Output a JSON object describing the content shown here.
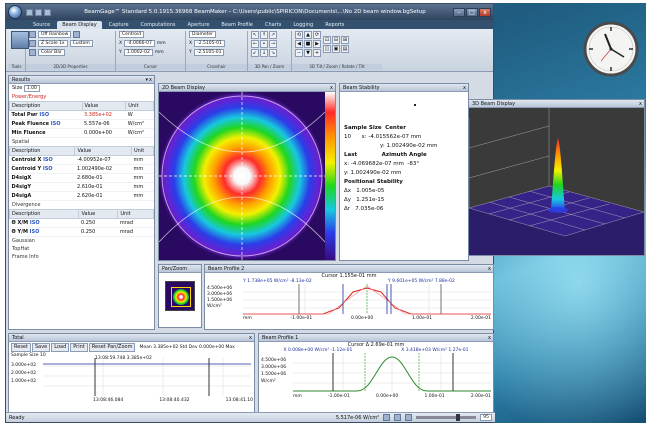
{
  "window": {
    "title": "BeamGage™ Standard 5.0.1915.36968 BeamMaker – C:\\Users\\public\\SPIRICON\\Documents\\...\\No 2D beam window.bgSetup",
    "minimize": "–",
    "maximize": "□",
    "close": "x"
  },
  "ribbon": {
    "tabs": [
      "Source",
      "Beam Display",
      "Capture",
      "Computations",
      "Aperture",
      "Beam Profile",
      "Charts",
      "Logging",
      "Reports"
    ],
    "active_tab": "Beam Display",
    "palette_label": "Off Rainbow",
    "scale_label": "Z Scale 1x",
    "colorbar_label": "Color Bar",
    "custom_label": "Custom",
    "centroid_label": "Centroid",
    "diameter_label": "Diameter",
    "x_value": "-4.0066-07",
    "y_value": "1.0002-02",
    "x2_value": "-2.5105-01",
    "y2_value": "-2.5105-01",
    "unit": "mm",
    "groups": [
      "Tools",
      "2D/3D Properties",
      "Cursor",
      "Crosshair",
      "3D Pan / Zoom",
      "3D Tilt / Zoom / Rotate / Tilt"
    ]
  },
  "results": {
    "title": "Results",
    "size_label": "Size",
    "size_value": "1.00",
    "sections": {
      "power": "Power/Energy",
      "spatial": "Spatial",
      "divergence": "Divergence",
      "gaussian": "Gaussian",
      "tophat": "TopHat",
      "frame": "Frame Info"
    },
    "columns": [
      "Description",
      "Value",
      "Unit"
    ],
    "power_rows": [
      {
        "desc": "Total Pwr",
        "iso": "ISO",
        "value": "3.385e+02",
        "unit": "W"
      },
      {
        "desc": "Peak Fluence",
        "iso": "ISO",
        "value": "5.557e-06",
        "unit": "W/cm²"
      },
      {
        "desc": "Min Fluence",
        "iso": "",
        "value": "0.000e+00",
        "unit": "W/cm²"
      }
    ],
    "spatial_rows": [
      {
        "desc": "Centroid X",
        "iso": "ISO",
        "value": "-4.00952e-07",
        "unit": "mm"
      },
      {
        "desc": "Centroid Y",
        "iso": "ISO",
        "value": "1.002490e-02",
        "unit": "mm"
      },
      {
        "desc": "D4sigX",
        "iso": "",
        "value": "2.680e-01",
        "unit": "mm"
      },
      {
        "desc": "D4sigY",
        "iso": "",
        "value": "2.610e-01",
        "unit": "mm"
      },
      {
        "desc": "D4sigA",
        "iso": "",
        "value": "2.620e-01",
        "unit": "mm"
      }
    ],
    "div_rows": [
      {
        "desc": "Θ X/M",
        "iso": "ISO",
        "value": "0.250",
        "unit": "mrad"
      },
      {
        "desc": "Θ Y/M",
        "iso": "ISO",
        "value": "0.250",
        "unit": "mrad"
      }
    ]
  },
  "beam2d": {
    "title": "2D Beam Display"
  },
  "stability": {
    "title": "Beam Stability",
    "sample_size_label": "Sample Size",
    "sample_size": "10",
    "center_label": "Center",
    "center_x": "-4.015562e-07 mm",
    "center_y": "1.002490e-02 mm",
    "last_label": "Last",
    "azimuth_label": "Azimuth Angle",
    "last_x": "-4.069682e-07 mm",
    "last_y": "1.002490e-02 mm",
    "angle": "-83°",
    "positional_label": "Positional Stability",
    "dx": "1.005e-05",
    "dy": "1.251e-15",
    "dr": "7.035e-06"
  },
  "beam3d": {
    "title": "3D Beam Display"
  },
  "panzoom": {
    "title": "Pan/Zoom"
  },
  "bp2": {
    "title": "Beam Profile 2",
    "cursor": "Cursor 1.155e-01 mm",
    "left_marker": "Y 1.738e+05 W/cm²  -8.13e-02",
    "right_marker": "Y 9.601e+05 W/cm²  7.88e-02",
    "y_ticks": [
      "4.500e+06",
      "3.000e+06",
      "1.500e+06"
    ],
    "y_unit": "W/cm²",
    "x_ticks": [
      "-2.00e-01",
      "-1.00e-01",
      "0.00e+00",
      "1.00e-01",
      "2.00e-01"
    ],
    "x_unit": "mm"
  },
  "total": {
    "title": "Total",
    "buttons": [
      "Reset",
      "Save",
      "Load",
      "Print",
      "Reset Pan/Zoom"
    ],
    "stats": "Mean 3.385e+02  Std Dev 0.000e+00  Max",
    "sample_size": "Sample Size 10",
    "marker": "13:08:59.748  3.385e+02",
    "y_ticks": [
      "3.000e+02",
      "2.000e+02",
      "1.000e+02"
    ],
    "x_ticks": [
      "13:08:46.084",
      "13:08:40.432",
      "13:08:41.10"
    ]
  },
  "bp1": {
    "title": "Beam Profile 1",
    "cursor": "Cursor Δ 2.69e-01 mm",
    "left_marker": "X 0.008e+00 W/cm²  -1.12e-01",
    "right_marker": "X 3.418e+03 W/cm²  1.27e-01",
    "y_ticks": [
      "4.500e+06",
      "3.000e+06",
      "1.500e+06"
    ],
    "y_unit": "W/cm²",
    "x_ticks": [
      "-2.00e-01",
      "-1.00e-01",
      "0.00e+00",
      "1.00e-01",
      "2.00e-01"
    ],
    "x_unit": "mm"
  },
  "status": {
    "ready": "Ready",
    "power": "5.517e-06 W/cm²",
    "zoom": "95"
  },
  "colors": {
    "red_value": "#d2261e",
    "iso_blue": "#2956c2",
    "ribbon_dark": "#34506f"
  }
}
